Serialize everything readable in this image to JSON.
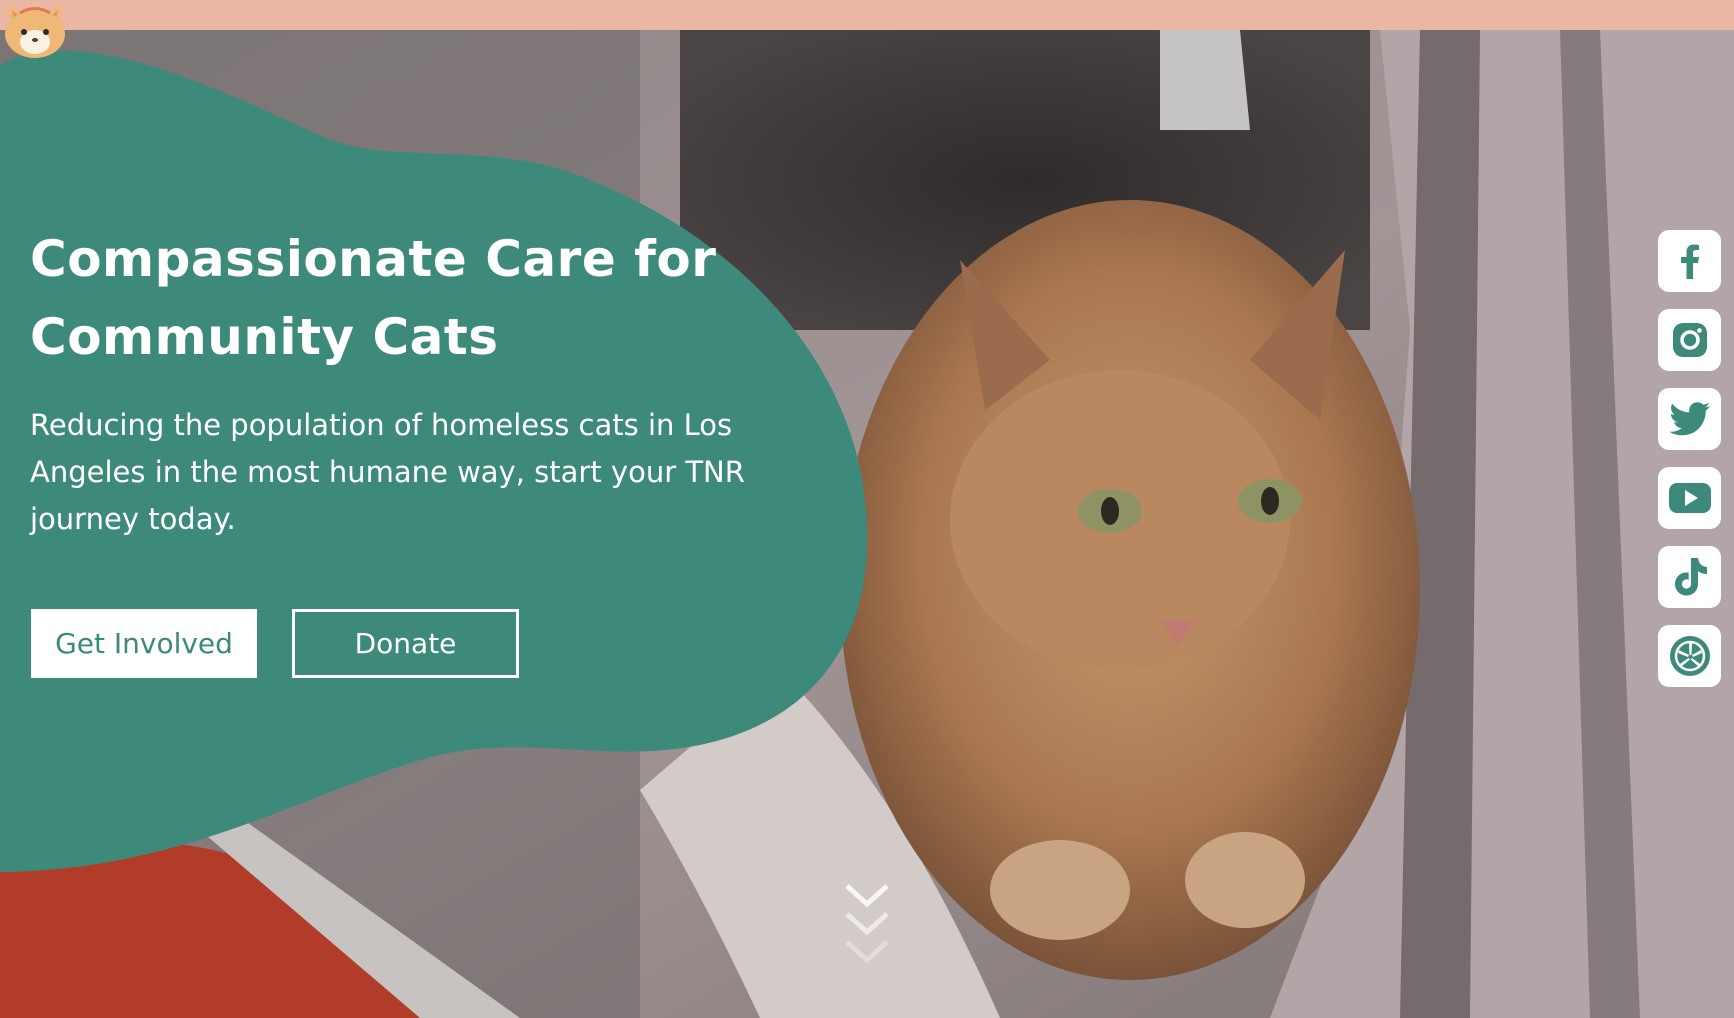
{
  "hero": {
    "headline": "Compassionate Care for Community Cats",
    "description": "Reducing the population of homeless cats in Los Angeles in the most humane way, start your TNR journey today.",
    "buttons": {
      "get_involved": "Get Involved",
      "donate": "Donate"
    }
  },
  "social_links": [
    "facebook-icon",
    "instagram-icon",
    "twitter-icon",
    "youtube-icon",
    "tiktok-icon",
    "yelp-icon"
  ],
  "colors": {
    "topbar": "#ebb6a3",
    "teal": "#3d8a7a",
    "white": "#ffffff"
  }
}
